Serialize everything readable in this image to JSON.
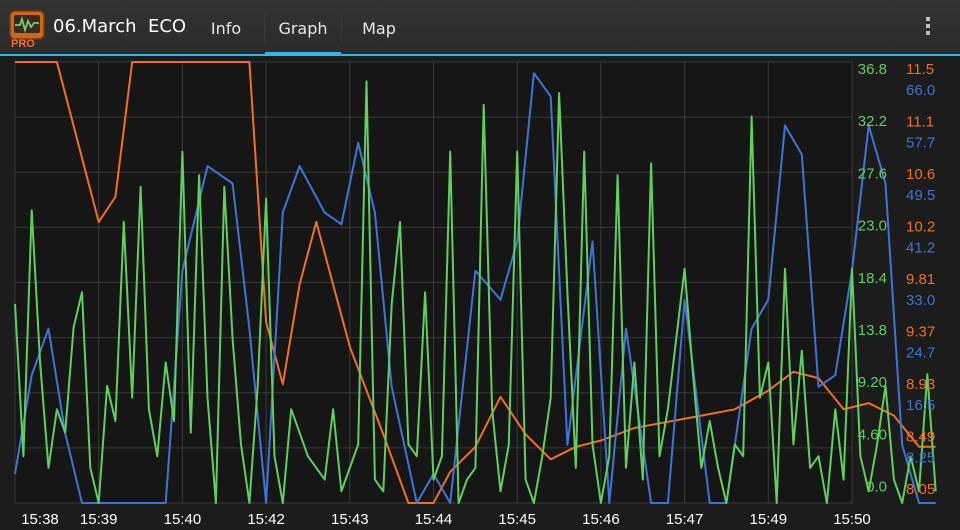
{
  "app": {
    "title": "06.March  ECO",
    "badge": "PRO"
  },
  "tabs": [
    {
      "label": "Info",
      "active": false
    },
    {
      "label": "Graph",
      "active": true
    },
    {
      "label": "Map",
      "active": false
    }
  ],
  "colors": {
    "accent": "#33b5e5",
    "green": "#5fcf5f",
    "orange": "#f07020",
    "blue": "#3f74d6"
  },
  "chart_data": {
    "type": "line",
    "x_ticks": [
      "15:38",
      "15:39",
      "15:40",
      "15:42",
      "15:43",
      "15:44",
      "15:45",
      "15:46",
      "15:47",
      "15:49",
      "15:50"
    ],
    "axes": [
      {
        "color": "green",
        "ticks": [
          "36.8",
          "32.2",
          "27.6",
          "23.0",
          "18.4",
          "13.8",
          "9.20",
          "4.60",
          "0.0"
        ],
        "range": [
          0,
          36.8
        ]
      },
      {
        "color": "orange",
        "ticks": [
          "11.5",
          "11.1",
          "10.6",
          "10.2",
          "9.81",
          "9.37",
          "8.93",
          "8.49",
          "8.05"
        ],
        "range": [
          8.05,
          11.5
        ]
      },
      {
        "color": "blue",
        "ticks": [
          "66.0",
          "57.7",
          "49.5",
          "41.2",
          "33.0",
          "24.7",
          "16.5",
          "8.25"
        ],
        "range": [
          0,
          74.2
        ]
      }
    ],
    "series": [
      {
        "color": "orange",
        "x": [
          0,
          0.5,
          1,
          1.2,
          1.4,
          1.6,
          1.8,
          2.3,
          2.8,
          3.0,
          3.2,
          3.4,
          3.6,
          4.0,
          4.4,
          4.7,
          5.0,
          5.2,
          5.5,
          5.8,
          6.1,
          6.4,
          6.7,
          7.0,
          7.4,
          7.8,
          8.2,
          8.6,
          9.0,
          9.3,
          9.6,
          9.9,
          10.2,
          10.5,
          10.8,
          11.0
        ],
        "y": [
          11.6,
          11.6,
          10.3,
          10.5,
          11.6,
          11.6,
          11.6,
          11.6,
          11.6,
          9.5,
          9.0,
          9.8,
          10.3,
          9.3,
          8.6,
          8.05,
          8.05,
          8.3,
          8.5,
          8.9,
          8.6,
          8.4,
          8.5,
          8.55,
          8.65,
          8.7,
          8.75,
          8.8,
          8.95,
          9.1,
          9.05,
          8.8,
          8.85,
          8.75,
          8.5,
          8.5
        ]
      },
      {
        "color": "blue",
        "x": [
          0,
          0.2,
          0.4,
          0.6,
          0.8,
          1.0,
          1.2,
          1.5,
          1.8,
          2.0,
          2.3,
          2.6,
          2.8,
          3.0,
          3.2,
          3.4,
          3.7,
          3.9,
          4.1,
          4.3,
          4.5,
          4.8,
          5.0,
          5.2,
          5.5,
          5.8,
          6.0,
          6.2,
          6.4,
          6.6,
          6.9,
          7.1,
          7.3,
          7.6,
          7.8,
          8.0,
          8.3,
          8.5,
          8.8,
          9.0,
          9.2,
          9.4,
          9.6,
          9.8,
          10.0,
          10.2,
          10.4,
          10.6,
          10.8,
          11.0
        ],
        "y": [
          5,
          22,
          30,
          12,
          0,
          0,
          0,
          0,
          0,
          40,
          58,
          55,
          30,
          0,
          50,
          58,
          50,
          48,
          62,
          50,
          20,
          0,
          5,
          0,
          40,
          35,
          45,
          74,
          70,
          10,
          45,
          0,
          30,
          0,
          0,
          35,
          0,
          0,
          30,
          35,
          65,
          60,
          20,
          22,
          40,
          65,
          55,
          10,
          0,
          0
        ]
      },
      {
        "color": "green",
        "x": [
          0,
          0.1,
          0.2,
          0.3,
          0.4,
          0.5,
          0.6,
          0.7,
          0.8,
          0.9,
          1.0,
          1.1,
          1.2,
          1.3,
          1.4,
          1.5,
          1.6,
          1.7,
          1.8,
          1.9,
          2.0,
          2.1,
          2.2,
          2.3,
          2.4,
          2.5,
          2.6,
          2.7,
          2.8,
          2.9,
          3.0,
          3.1,
          3.2,
          3.3,
          3.4,
          3.5,
          3.6,
          3.7,
          3.8,
          3.9,
          4.0,
          4.1,
          4.2,
          4.3,
          4.4,
          4.5,
          4.6,
          4.7,
          4.8,
          4.9,
          5.0,
          5.1,
          5.2,
          5.3,
          5.4,
          5.5,
          5.6,
          5.7,
          5.8,
          5.9,
          6.0,
          6.1,
          6.2,
          6.3,
          6.4,
          6.5,
          6.6,
          6.7,
          6.8,
          6.9,
          7.0,
          7.1,
          7.2,
          7.3,
          7.4,
          7.5,
          7.6,
          7.7,
          7.8,
          7.9,
          8.0,
          8.1,
          8.2,
          8.3,
          8.4,
          8.5,
          8.6,
          8.7,
          8.8,
          8.9,
          9.0,
          9.1,
          9.2,
          9.3,
          9.4,
          9.5,
          9.6,
          9.7,
          9.8,
          9.9,
          10.0,
          10.1,
          10.2,
          10.3,
          10.4,
          10.5,
          10.6,
          10.7,
          10.8,
          10.9,
          11.0
        ],
        "y": [
          17,
          4,
          25,
          12,
          3,
          8,
          6,
          15,
          18,
          3,
          0,
          10,
          7,
          24,
          9,
          27,
          8,
          4,
          12,
          7,
          30,
          6,
          28,
          9,
          0,
          27,
          14,
          5,
          0,
          10,
          26,
          4,
          0,
          8,
          6,
          4,
          3,
          2,
          8,
          1,
          3,
          5,
          36,
          2,
          1,
          17,
          24,
          5,
          4,
          18,
          2,
          4,
          30,
          0,
          2,
          3,
          34,
          8,
          1,
          5,
          30,
          2,
          0,
          4,
          9,
          35,
          18,
          3,
          30,
          5,
          0,
          4,
          28,
          3,
          12,
          2,
          29,
          4,
          8,
          14,
          20,
          11,
          3,
          7,
          3,
          0,
          5,
          4,
          33,
          9,
          12,
          0,
          20,
          5,
          13,
          3,
          4,
          0,
          8,
          2,
          20,
          4,
          1,
          5,
          10,
          2,
          0,
          4,
          1,
          11,
          1
        ]
      }
    ]
  }
}
